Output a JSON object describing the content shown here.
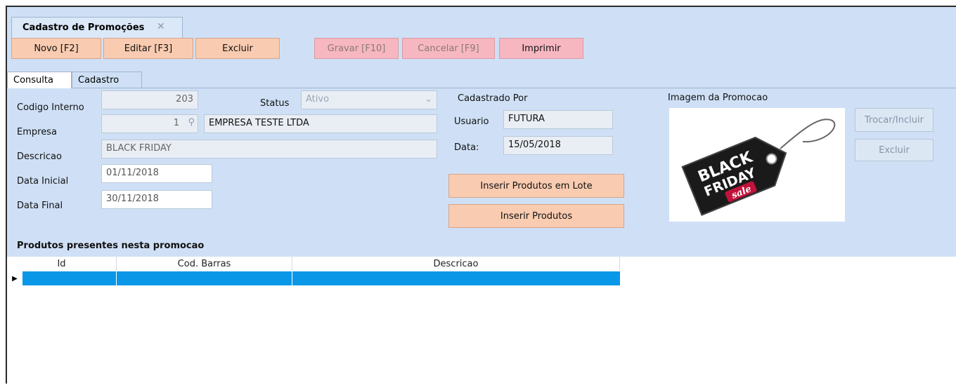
{
  "window": {
    "tab_title": "Cadastro de Promoções",
    "close_glyph": "✕"
  },
  "toolbar": {
    "novo": "Novo [F2]",
    "editar": "Editar [F3]",
    "excluir": "Excluir",
    "gravar": "Gravar [F10]",
    "cancelar": "Cancelar [F9]",
    "imprimir": "Imprimir"
  },
  "subtabs": {
    "consulta": "Consulta",
    "cadastro": "Cadastro"
  },
  "form": {
    "codigo_label": "Codigo Interno",
    "codigo_value": "203",
    "status_label": "Status",
    "status_value": "Ativo",
    "empresa_label": "Empresa",
    "empresa_code": "1",
    "empresa_name": "EMPRESA TESTE LTDA",
    "descricao_label": "Descricao",
    "descricao_value": "BLACK FRIDAY",
    "data_inicial_label": "Data Inicial",
    "data_inicial_value": "01/11/2018",
    "data_final_label": "Data Final",
    "data_final_value": "30/11/2018"
  },
  "cadastrado": {
    "title": "Cadastrado Por",
    "usuario_label": "Usuario",
    "usuario_value": "FUTURA",
    "data_label": "Data:",
    "data_value": "15/05/2018"
  },
  "actions": {
    "inserir_lote": "Inserir Produtos em Lote",
    "inserir": "Inserir Produtos"
  },
  "imagem": {
    "title": "Imagem da Promocao",
    "tag_line1": "BLACK",
    "tag_line2": "FRIDAY",
    "tag_line3": "sale",
    "trocar": "Trocar/Incluir",
    "excluir": "Excluir"
  },
  "grid": {
    "section_title": "Produtos presentes nesta promocao",
    "columns": [
      "Id",
      "Cod. Barras",
      "Descricao"
    ]
  },
  "colors": {
    "background": "#cfe0f6",
    "button": "#f9cbb0",
    "selected_row": "#0a97e8"
  }
}
